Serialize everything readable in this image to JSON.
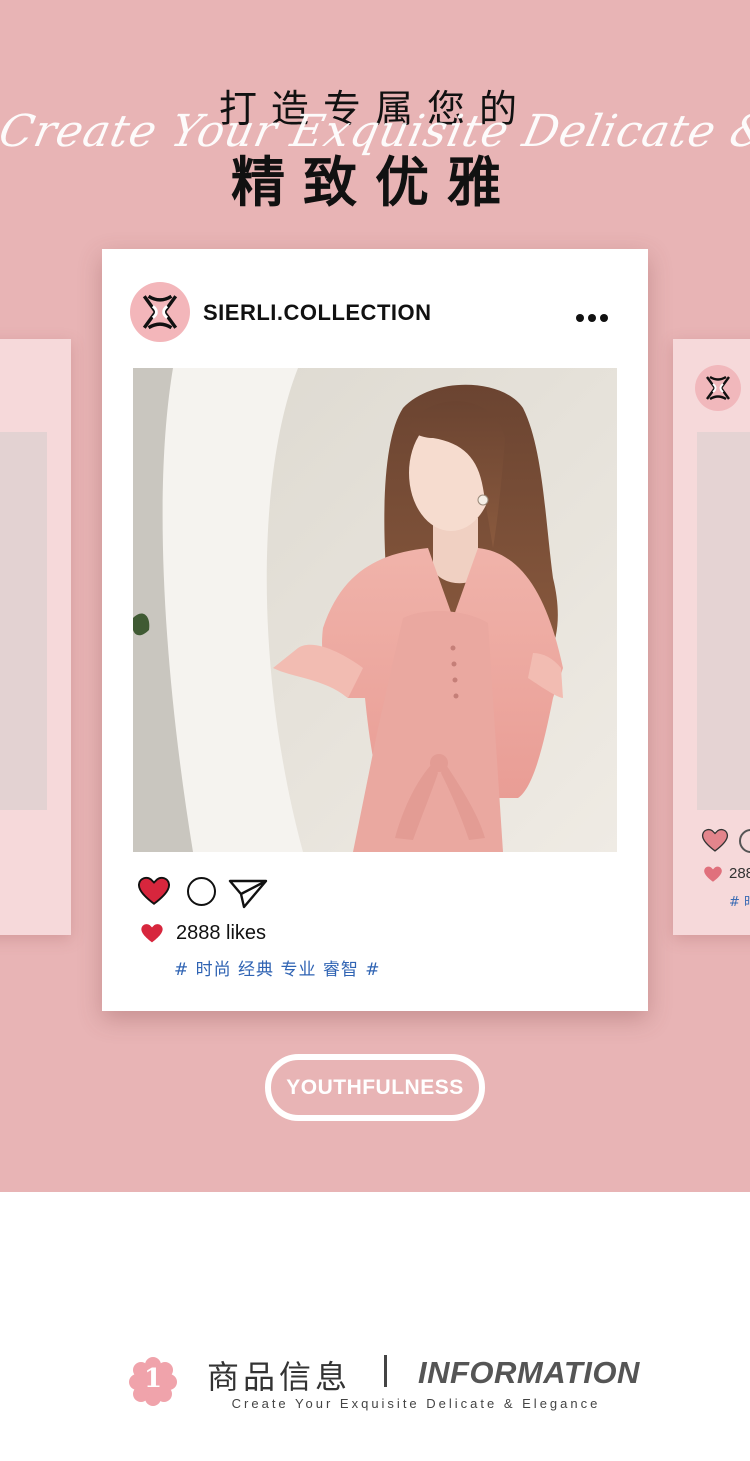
{
  "header": {
    "title_line1": "打造专属您的",
    "script_text": "Create Your Exquisite Delicate & Elegance",
    "title_line2": "精致优雅"
  },
  "post": {
    "username": "SIERLI.COLLECTION",
    "likes": "2888 likes",
    "tags": "# 时尚 经典 专业 睿智 #",
    "icons": [
      "brand-logo-icon",
      "more-dots-icon",
      "heart-icon",
      "comment-icon",
      "send-icon"
    ]
  },
  "side_card": {
    "likes": "288",
    "tag": "# 时"
  },
  "badge": {
    "label": "YOUTHFULNESS"
  },
  "info": {
    "number": "1",
    "cn": "商品信息",
    "en": "INFORMATION",
    "sub": "Create Your Exquisite Delicate & Elegance"
  },
  "colors": {
    "background_pink": "#e8b4b5",
    "card_pink": "#f6d9da",
    "heart_red": "#d7263d",
    "tag_blue": "#2f63b3"
  }
}
